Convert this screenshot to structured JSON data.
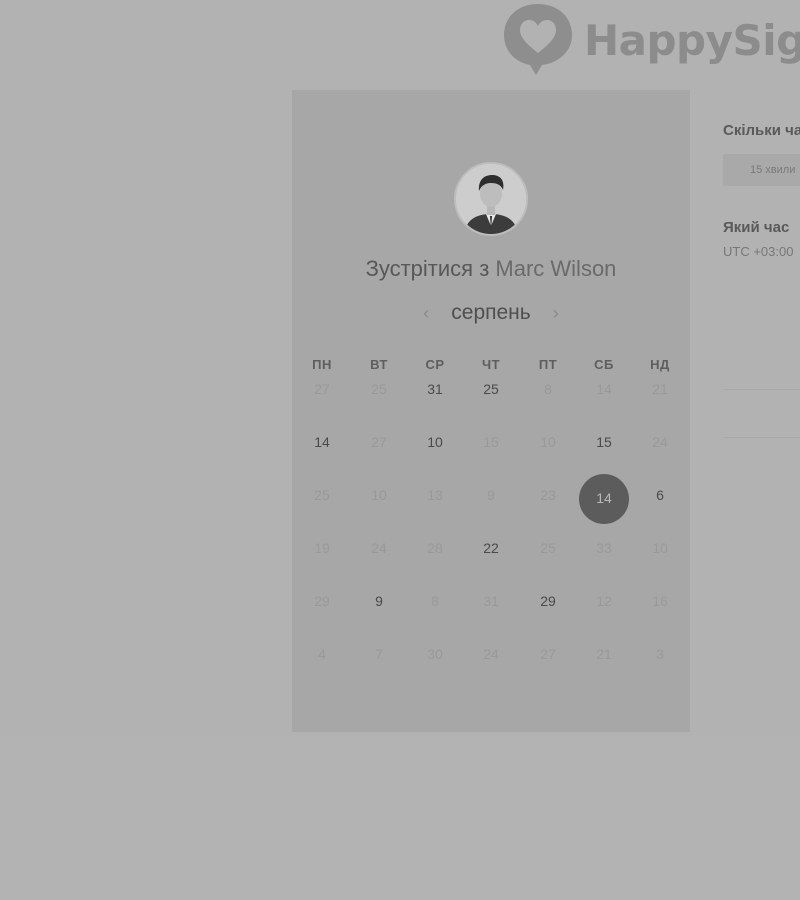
{
  "brand": {
    "name": "HappySig",
    "logo_icon": "heart-speech-bubble-icon"
  },
  "booking": {
    "title_prefix": "Зустрітися з",
    "host_name": "Marc Wilson",
    "month": "серпень",
    "prev_icon": "chevron-left-icon",
    "next_icon": "chevron-right-icon"
  },
  "calendar": {
    "weekdays": [
      "ПН",
      "ВТ",
      "СР",
      "ЧТ",
      "ПТ",
      "СБ",
      "НД"
    ],
    "weeks": [
      [
        {
          "d": "27",
          "a": false
        },
        {
          "d": "25",
          "a": false
        },
        {
          "d": "31",
          "a": true
        },
        {
          "d": "25",
          "a": true
        },
        {
          "d": "8",
          "a": false
        },
        {
          "d": "14",
          "a": false
        },
        {
          "d": "21",
          "a": false
        }
      ],
      [
        {
          "d": "14",
          "a": true
        },
        {
          "d": "27",
          "a": false
        },
        {
          "d": "10",
          "a": true
        },
        {
          "d": "15",
          "a": false
        },
        {
          "d": "10",
          "a": false
        },
        {
          "d": "15",
          "a": true
        },
        {
          "d": "24",
          "a": false
        }
      ],
      [
        {
          "d": "25",
          "a": false
        },
        {
          "d": "10",
          "a": false
        },
        {
          "d": "13",
          "a": false
        },
        {
          "d": "9",
          "a": false
        },
        {
          "d": "23",
          "a": false
        },
        {
          "d": "14",
          "a": true,
          "selected": true
        },
        {
          "d": "6",
          "a": true
        }
      ],
      [
        {
          "d": "19",
          "a": false
        },
        {
          "d": "24",
          "a": false
        },
        {
          "d": "28",
          "a": false
        },
        {
          "d": "22",
          "a": true
        },
        {
          "d": "25",
          "a": false
        },
        {
          "d": "33",
          "a": false
        },
        {
          "d": "10",
          "a": false
        }
      ],
      [
        {
          "d": "29",
          "a": false
        },
        {
          "d": "9",
          "a": true
        },
        {
          "d": "8",
          "a": false
        },
        {
          "d": "31",
          "a": false
        },
        {
          "d": "29",
          "a": true
        },
        {
          "d": "12",
          "a": false
        },
        {
          "d": "16",
          "a": false
        }
      ],
      [
        {
          "d": "4",
          "a": false
        },
        {
          "d": "7",
          "a": false
        },
        {
          "d": "30",
          "a": false
        },
        {
          "d": "24",
          "a": false
        },
        {
          "d": "27",
          "a": false
        },
        {
          "d": "21",
          "a": false
        },
        {
          "d": "3",
          "a": false
        }
      ]
    ]
  },
  "side": {
    "duration_question": "Скільки ча",
    "duration_option": "15 хвили",
    "time_question": "Який час",
    "timezone": "UTC +03:00"
  },
  "colors": {
    "selected_day_bg": "#5c5c5c",
    "card_bg": "#a7a7a7",
    "page_bg": "#b2b2b2"
  }
}
